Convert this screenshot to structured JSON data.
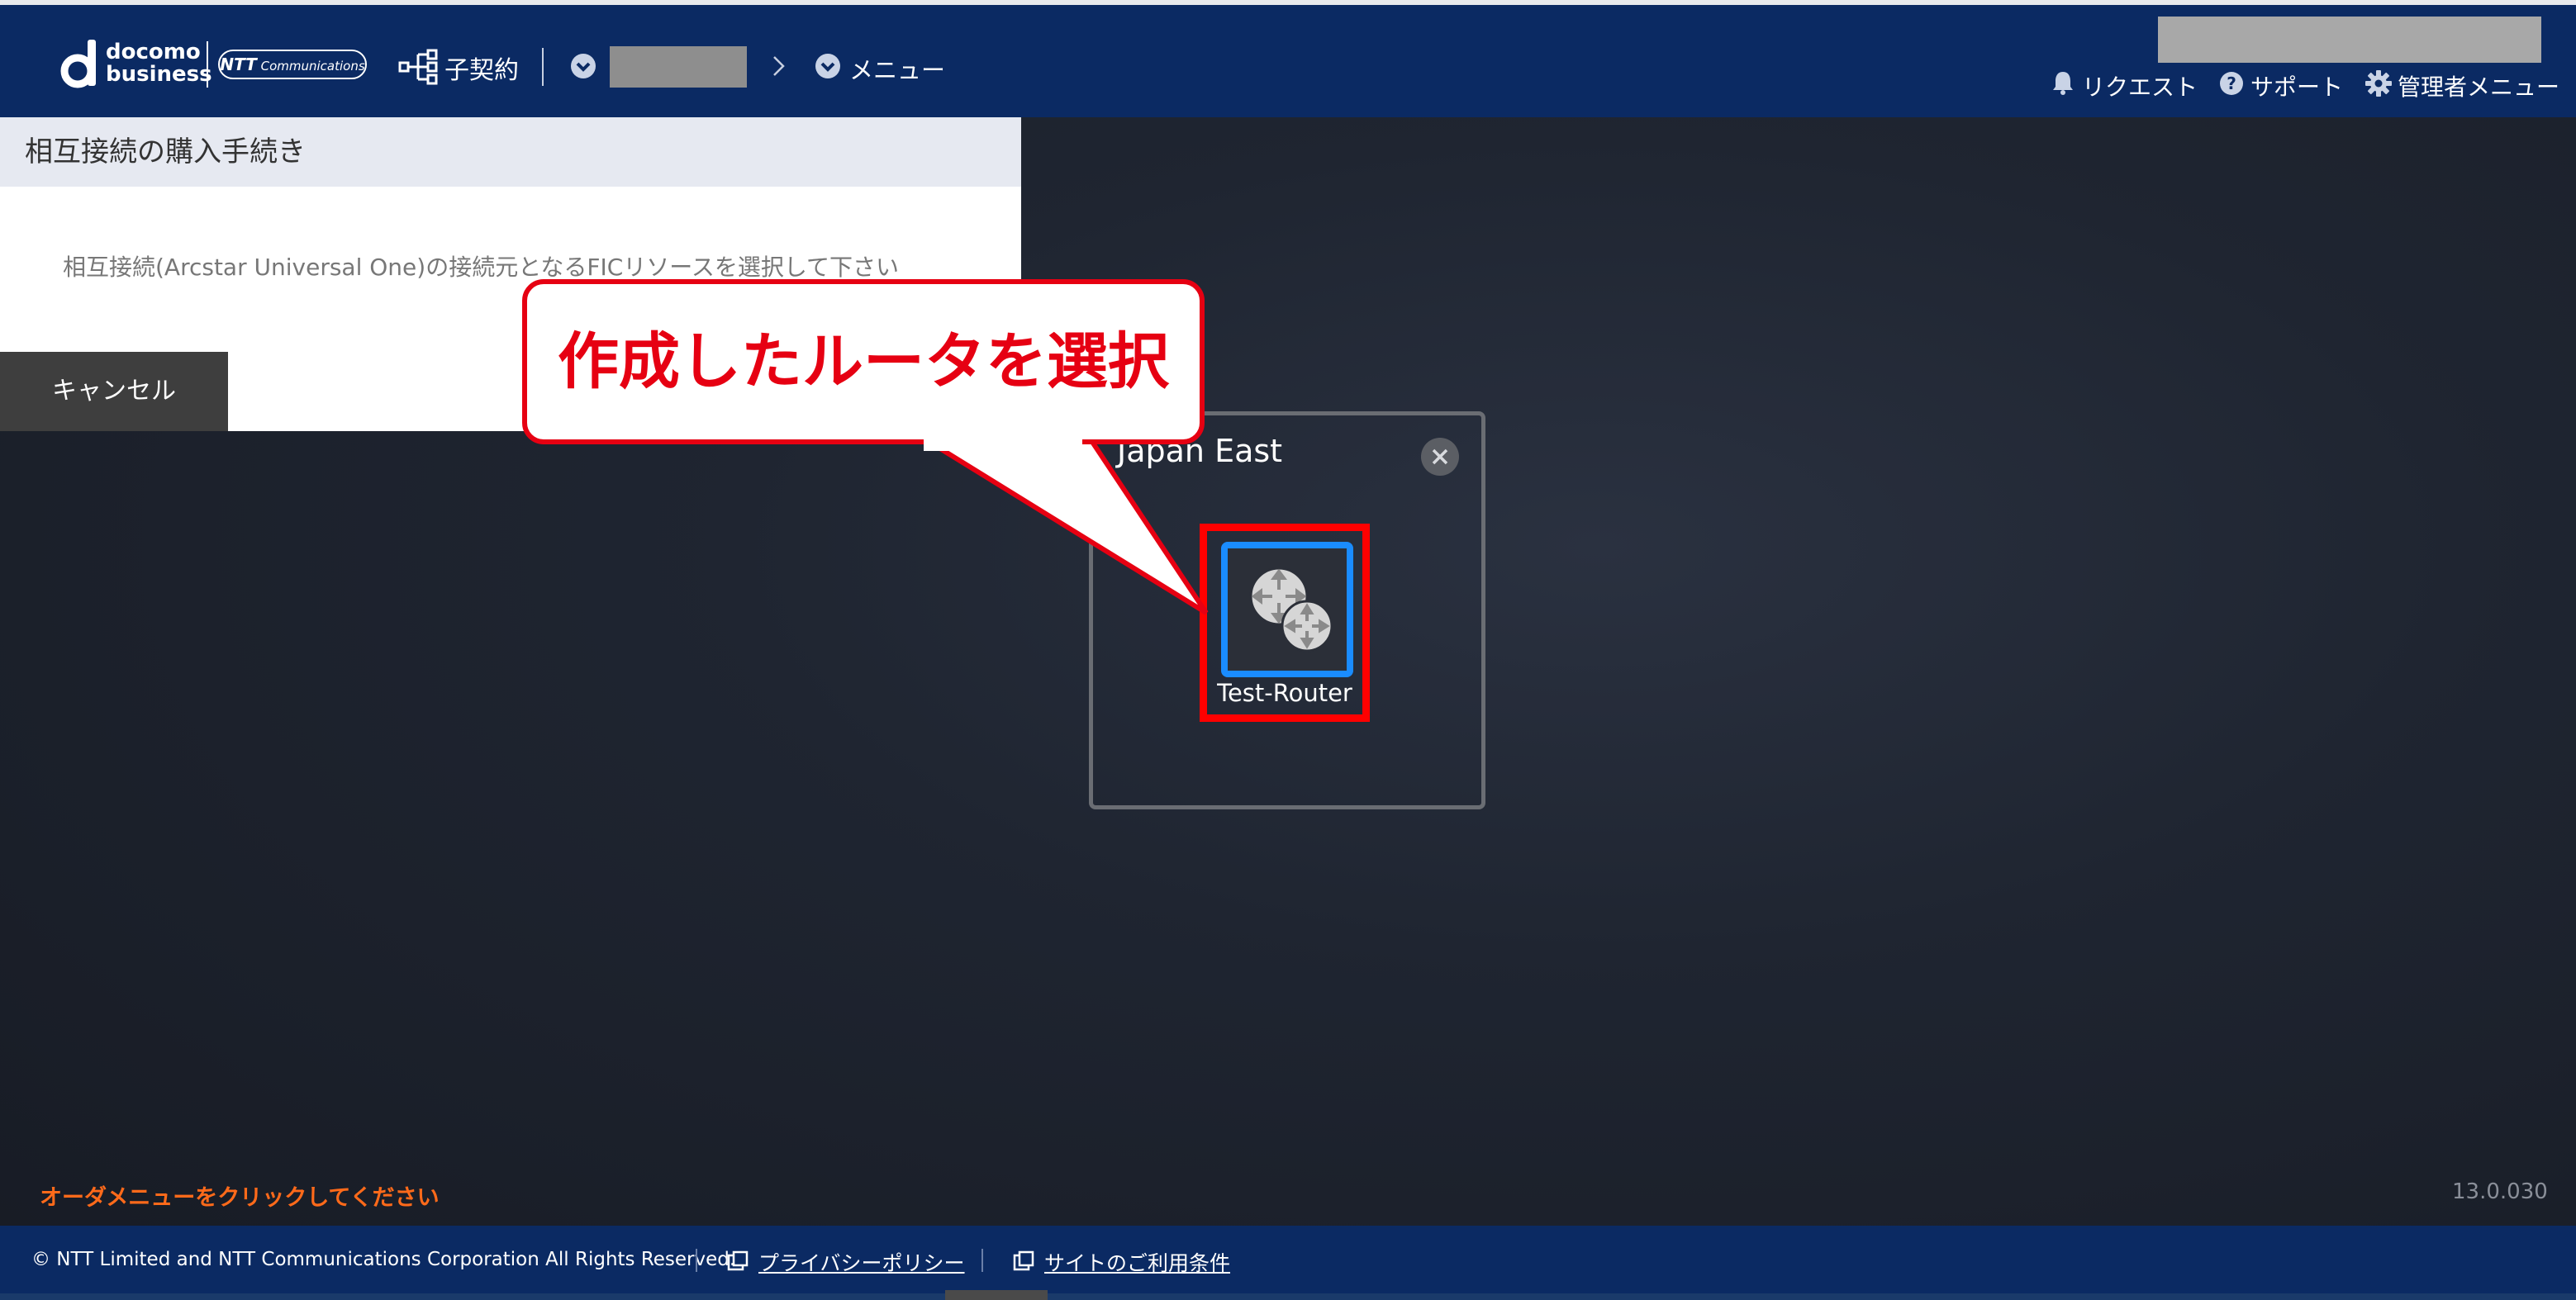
{
  "header": {
    "logo_line1": "docomo",
    "logo_line2": "business",
    "ntt_logo_bold": "NTT",
    "ntt_logo_rest": "Communications",
    "sub_contract_label": "子契約",
    "breadcrumb_menu_label": "メニュー",
    "links": {
      "request": "リクエスト",
      "support": "サポート",
      "admin_menu": "管理者メニュー"
    }
  },
  "panel": {
    "title": "相互接続の購入手続き",
    "description": "相互接続(Arcstar Universal One)の接続元となるFICリソースを選択して下さい",
    "cancel_label": "キャンセル"
  },
  "region": {
    "title": "Japan East",
    "router_label": "Test-Router"
  },
  "callout": {
    "text": "作成したルータを選択"
  },
  "status": {
    "order_hint": "オーダメニューをクリックしてください",
    "version": "13.0.030"
  },
  "footer": {
    "copyright": "© NTT Limited and NTT Communications Corporation All Rights Reserved.",
    "privacy_label": "プライバシーポリシー",
    "terms_label": "サイトのご利用条件"
  },
  "colors": {
    "header_bg": "#0b2a63",
    "highlight_red": "#e60012",
    "router_blue": "#1a8cff",
    "order_hint_orange": "#ff6a1a"
  },
  "icons": [
    "docomo-d-logo",
    "hierarchy-icon",
    "check-circle-icon",
    "chevron-right-icon",
    "bell-icon",
    "help-icon",
    "gear-icon",
    "close-icon",
    "router-icon",
    "external-link-icon"
  ]
}
